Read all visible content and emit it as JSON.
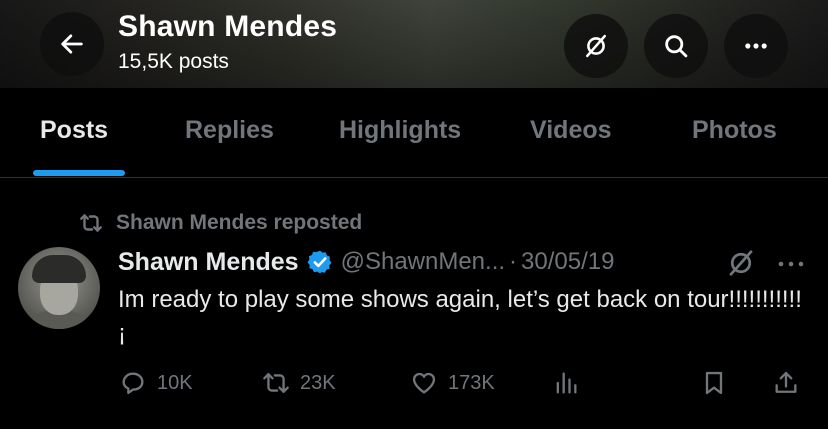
{
  "header": {
    "name": "Shawn Mendes",
    "posts_count": "15,5K posts",
    "icons": [
      "back-arrow-icon",
      "grok-icon",
      "search-icon",
      "more-icon"
    ]
  },
  "tabs": [
    {
      "label": "Posts",
      "active": true
    },
    {
      "label": "Replies",
      "active": false
    },
    {
      "label": "Highlights",
      "active": false
    },
    {
      "label": "Videos",
      "active": false
    },
    {
      "label": "Photos",
      "active": false
    }
  ],
  "colors": {
    "accent": "#1d9bf0",
    "muted_text": "#71767b",
    "primary_text": "#e7e9ea",
    "background": "#000000"
  },
  "tweet": {
    "repost_label": "Shawn Mendes reposted",
    "author_name": "Shawn Mendes",
    "handle": "@ShawnMen...",
    "separator": "·",
    "date": "30/05/19",
    "text": "Im ready to play some shows again, let’s get back on tour!!!!!!!!!!!¡",
    "actions": {
      "replies": "10K",
      "reposts": "23K",
      "likes": "173K"
    }
  }
}
